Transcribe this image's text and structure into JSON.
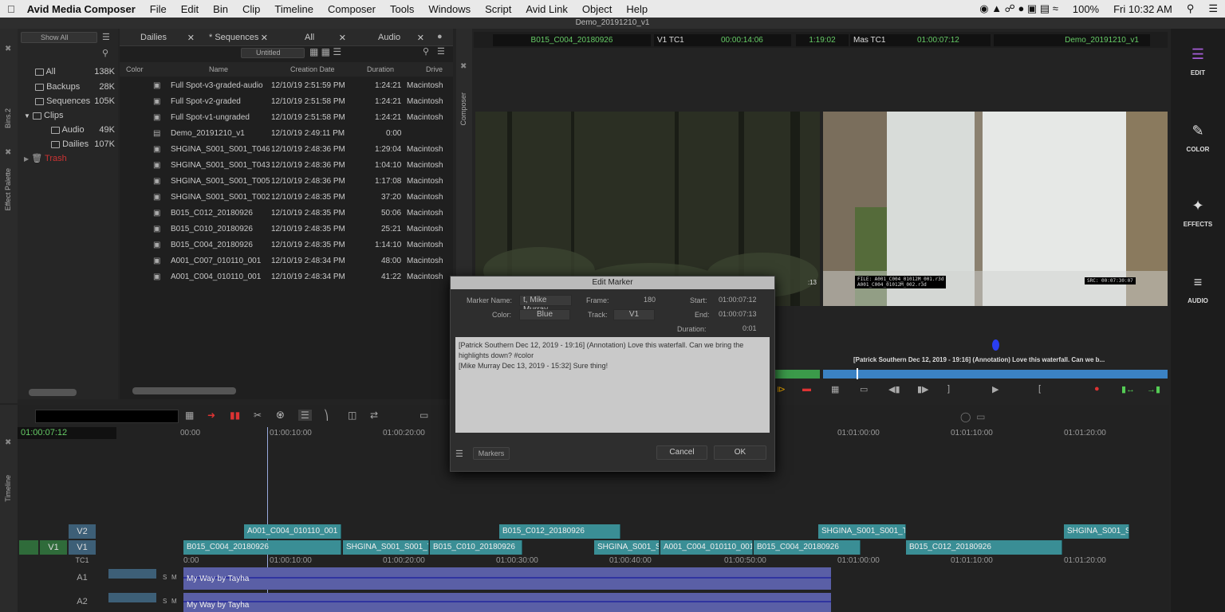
{
  "menubar": {
    "app": "Avid Media Composer",
    "items": [
      "File",
      "Edit",
      "Bin",
      "Clip",
      "Timeline",
      "Composer",
      "Tools",
      "Windows",
      "Script",
      "Avid Link",
      "Object",
      "Help"
    ],
    "battery": "100%",
    "clock": "Fri 10:32 AM"
  },
  "window_title": "Demo_20191210_v1",
  "bins": {
    "show_all": "Show All",
    "items": [
      {
        "label": "All",
        "size": "138K"
      },
      {
        "label": "Backups",
        "size": "28K"
      },
      {
        "label": "Sequences",
        "size": "105K"
      },
      {
        "label": "Clips",
        "size": ""
      },
      {
        "label": "Audio",
        "size": "49K"
      },
      {
        "label": "Dailies",
        "size": "107K"
      },
      {
        "label": "Trash",
        "size": ""
      }
    ],
    "side_label": "Bins.2",
    "side_label2": "Effect Palette"
  },
  "bin_tabs": [
    "Dailies",
    "* Sequences",
    "All",
    "Audio"
  ],
  "bin_view": "Untitled",
  "bin_columns": [
    "Color",
    "Name",
    "Creation Date",
    "Duration",
    "Drive"
  ],
  "bin_rows": [
    {
      "name": "Full Spot-v3-graded-audio",
      "date": "12/10/19 2:51:59 PM",
      "dur": "1:24:21",
      "drive": "Macintosh"
    },
    {
      "name": "Full Spot-v2-graded",
      "date": "12/10/19 2:51:58 PM",
      "dur": "1:24:21",
      "drive": "Macintosh"
    },
    {
      "name": "Full Spot-v1-ungraded",
      "date": "12/10/19 2:51:58 PM",
      "dur": "1:24:21",
      "drive": "Macintosh"
    },
    {
      "name": "Demo_20191210_v1",
      "date": "12/10/19 2:49:11 PM",
      "dur": "0:00",
      "drive": ""
    },
    {
      "name": "SHGINA_S001_S001_T046",
      "date": "12/10/19 2:48:36 PM",
      "dur": "1:29:04",
      "drive": "Macintosh"
    },
    {
      "name": "SHGINA_S001_S001_T043",
      "date": "12/10/19 2:48:36 PM",
      "dur": "1:04:10",
      "drive": "Macintosh"
    },
    {
      "name": "SHGINA_S001_S001_T005",
      "date": "12/10/19 2:48:36 PM",
      "dur": "1:17:08",
      "drive": "Macintosh"
    },
    {
      "name": "SHGINA_S001_S001_T002",
      "date": "12/10/19 2:48:35 PM",
      "dur": "37:20",
      "drive": "Macintosh"
    },
    {
      "name": "B015_C012_20180926",
      "date": "12/10/19 2:48:35 PM",
      "dur": "50:06",
      "drive": "Macintosh"
    },
    {
      "name": "B015_C010_20180926",
      "date": "12/10/19 2:48:35 PM",
      "dur": "25:21",
      "drive": "Macintosh"
    },
    {
      "name": "B015_C004_20180926",
      "date": "12/10/19 2:48:35 PM",
      "dur": "1:14:10",
      "drive": "Macintosh"
    },
    {
      "name": "A001_C007_010110_001",
      "date": "12/10/19 2:48:34 PM",
      "dur": "48:00",
      "drive": "Macintosh"
    },
    {
      "name": "A001_C004_010110_001",
      "date": "12/10/19 2:48:34 PM",
      "dur": "41:22",
      "drive": "Macintosh"
    }
  ],
  "composer": {
    "label": "Composer",
    "src_clip": "B015_C004_20180926",
    "v1tc": "V1 TC1",
    "v1tc_val": "00:00:14:06",
    "dur": "1:19:02",
    "mas": "Mas TC1",
    "mas_val": "01:00:07:12",
    "rec_seq": "Demo_20191210_v1",
    "burnin_left": "FILE: A001_C004_01012M_001.r3d",
    "burnin_left2": "A001_C004_01012M_002.r3d",
    "burnin_right": "SRC: 00:07:30:07",
    "tc_small": ":13",
    "annotation": "[Patrick Southern Dec 12, 2019 - 19:16] (Annotation) Love this waterfall. Can we b..."
  },
  "dialog": {
    "title": "Edit Marker",
    "marker_name_label": "Marker Name:",
    "marker_name": "t, Mike Murray",
    "frame_label": "Frame:",
    "frame": "180",
    "start_label": "Start:",
    "start": "01:00:07:12",
    "color_label": "Color:",
    "color": "Blue",
    "track_label": "Track:",
    "track": "V1",
    "end_label": "End:",
    "end": "01:00:07:13",
    "duration_label": "Duration:",
    "duration": "0:01",
    "comment": "[Patrick Southern Dec 12, 2019 - 19:16] (Annotation) Love this waterfall. Can we bring the highlights down? #color\n[Mike Murray Dec 13, 2019 - 15:32] Sure thing!",
    "markers_btn": "Markers",
    "cancel": "Cancel",
    "ok": "OK"
  },
  "timeline": {
    "label": "Timeline",
    "tc": "01:00:07:12",
    "ruler": [
      "00:00",
      "01:00:10:00",
      "01:00:20:00",
      "01:01:00:00",
      "01:01:10:00",
      "01:01:20:00"
    ],
    "tc1_ruler": [
      "0:00",
      "01:00:10:00",
      "01:00:20:00",
      "01:00:30:00",
      "01:00:40:00",
      "01:00:50:00",
      "01:01:00:00",
      "01:01:10:00",
      "01:01:20:00"
    ],
    "tracks": {
      "v2": "V2",
      "v1": "V1",
      "v1src": "V1",
      "tc1": "TC1",
      "a1": "A1",
      "a2": "A2",
      "s": "S",
      "m": "M"
    },
    "v2_clips": [
      "A001_C004_010110_001",
      "B015_C012_20180926",
      "SHGINA_S001_S001_T0",
      "SHGINA_S001_S"
    ],
    "v1_clips": [
      "B015_C004_20180926",
      "SHGINA_S001_S001_T0",
      "B015_C010_20180926",
      "SHGINA_S001_S0",
      "A001_C004_010110_001",
      "B015_C004_20180926",
      "B015_C012_20180926"
    ],
    "audio_clip": "My Way by Tayha"
  },
  "right_rail": [
    "EDIT",
    "COLOR",
    "EFFECTS",
    "AUDIO"
  ]
}
